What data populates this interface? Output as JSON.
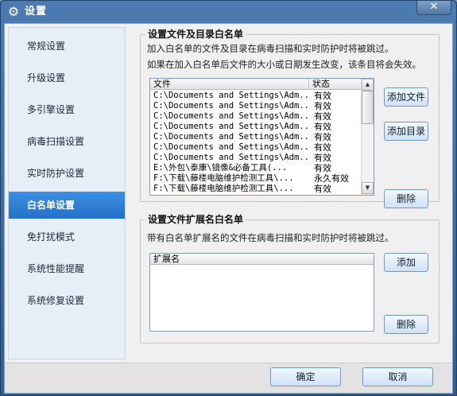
{
  "window": {
    "title": "设置",
    "close_symbol": "✕"
  },
  "sidebar": {
    "items": [
      {
        "label": "常规设置"
      },
      {
        "label": "升级设置"
      },
      {
        "label": "多引擎设置"
      },
      {
        "label": "病毒扫描设置"
      },
      {
        "label": "实时防护设置"
      },
      {
        "label": "白名单设置",
        "active": true
      },
      {
        "label": "免打扰模式"
      },
      {
        "label": "系统性能提醒"
      },
      {
        "label": "系统修复设置"
      }
    ]
  },
  "file_whitelist": {
    "title": "设置文件及目录白名单",
    "desc1": "加入白名单的文件及目录在病毒扫描和实时防护时将被跳过。",
    "desc2": "如果在加入白名单后文件的大小或日期发生改变，该条目将会失效。",
    "columns": [
      "文件",
      "状态"
    ],
    "rows": [
      {
        "file": "C:\\Documents and Settings\\Adm...",
        "status": "有效"
      },
      {
        "file": "C:\\Documents and Settings\\Adm...",
        "status": "有效"
      },
      {
        "file": "C:\\Documents and Settings\\Adm...",
        "status": "有效"
      },
      {
        "file": "C:\\Documents and Settings\\Adm...",
        "status": "有效"
      },
      {
        "file": "C:\\Documents and Settings\\Adm...",
        "status": "有效"
      },
      {
        "file": "C:\\Documents and Settings\\Adm...",
        "status": "有效"
      },
      {
        "file": "C:\\Documents and Settings\\Adm...",
        "status": "有效"
      },
      {
        "file": "E:\\外包\\泰康\\镜像&必备工具(...",
        "status": "有效"
      },
      {
        "file": "F:\\下载\\藤楼电脑维护检测工具\\...",
        "status": "永久有效"
      },
      {
        "file": "F:\\下载\\藤楼电脑维护检测工具\\...",
        "status": "有效"
      }
    ],
    "buttons": {
      "add_file": "添加文件",
      "add_dir": "添加目录",
      "delete": "删除"
    }
  },
  "ext_whitelist": {
    "title": "设置文件扩展名白名单",
    "desc": "带有白名单扩展名的文件在病毒扫描和实时防护时将被跳过。",
    "columns": [
      "扩展名"
    ],
    "buttons": {
      "add": "添加",
      "delete": "删除"
    }
  },
  "footer": {
    "ok": "确定",
    "cancel": "取消"
  }
}
